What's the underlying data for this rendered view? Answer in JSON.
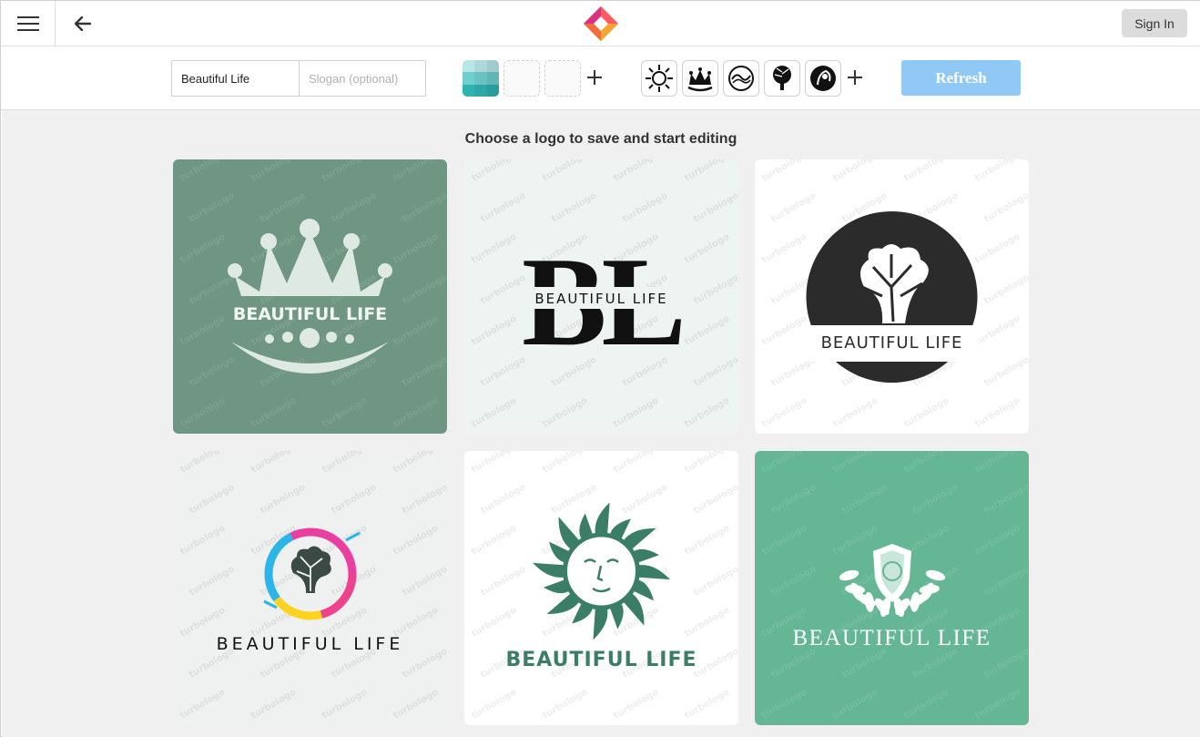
{
  "header": {
    "menu_icon": "hamburger-icon",
    "back_icon": "arrow-left-icon",
    "brand_icon": "diamond-logo-icon",
    "signin_label": "Sign In"
  },
  "toolbar": {
    "name_value": "Beautiful Life",
    "slogan_placeholder": "Slogan (optional)",
    "add_color_icon": "plus-icon",
    "icon_thumbs": [
      "sun-icon",
      "crown-icon",
      "shield-wave-icon",
      "tree-icon",
      "circle-tree-icon"
    ],
    "add_icon_icon": "plus-icon",
    "refresh_label": "Refresh",
    "palette_colors": [
      "#8fd6d6",
      "#6fc9c9",
      "#4bbcbc",
      "#2aa7a9"
    ]
  },
  "main": {
    "heading": "Choose a logo to save and start editing",
    "watermark": "turbologo",
    "logos": [
      {
        "text": "BEAUTIFUL LIFE",
        "style": "crown",
        "bg": "#6e9682"
      },
      {
        "text": "BEAUTIFUL LIFE",
        "monogram": "BL",
        "style": "monogram",
        "bg": "#eef4f2"
      },
      {
        "text": "BEAUTIFUL LIFE",
        "style": "tree-circle",
        "bg": "#ffffff"
      },
      {
        "text": "BEAUTIFUL LIFE",
        "style": "ring-tree",
        "bg": "#eef1f0"
      },
      {
        "text": "BEAUTIFUL LIFE",
        "style": "sun",
        "bg": "#ffffff"
      },
      {
        "text": "BEAUTIFUL LIFE",
        "style": "laurel",
        "bg": "#64b694"
      }
    ]
  }
}
